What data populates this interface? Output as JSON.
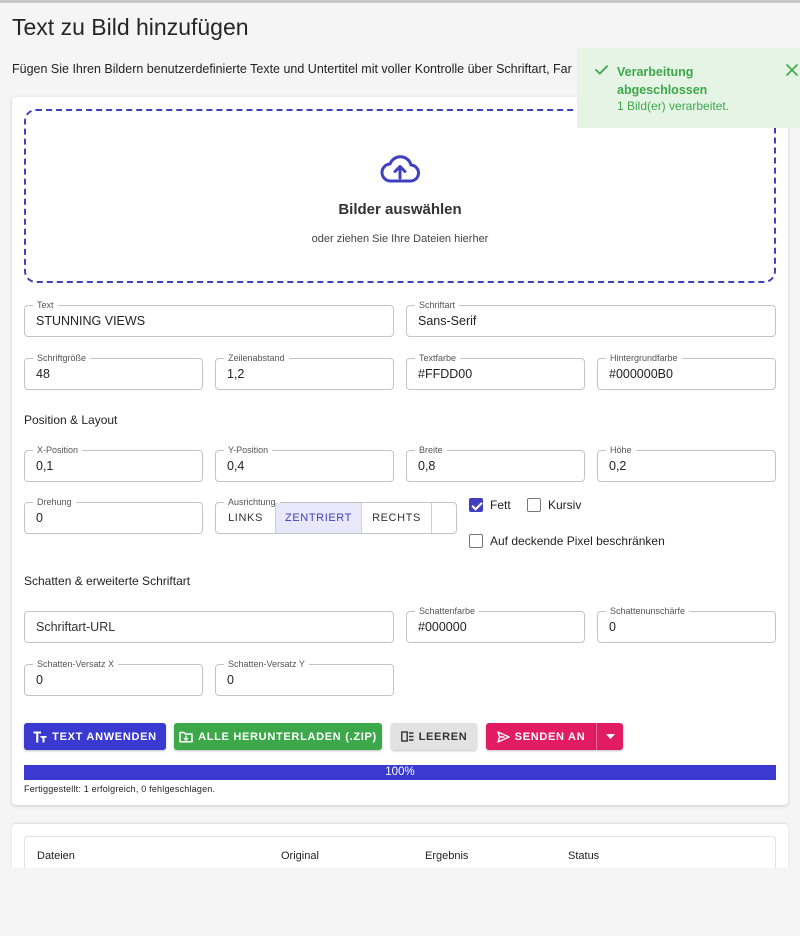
{
  "page": {
    "title": "Text zu Bild hinzufügen",
    "subtitle": "Fügen Sie Ihren Bildern benutzerdefinierte Texte und Untertitel mit voller Kontrolle über Schriftart, Farbe, Position und Schatten hinzu."
  },
  "dropzone": {
    "title": "Bilder auswählen",
    "subtitle": "oder ziehen Sie Ihre Dateien hierher",
    "icon": "cloud-upload-icon"
  },
  "fields": {
    "text": {
      "label": "Text",
      "value": "STUNNING VIEWS"
    },
    "font": {
      "label": "Schriftart",
      "value": "Sans-Serif"
    },
    "font_size": {
      "label": "Schriftgröße",
      "value": "48"
    },
    "line_height": {
      "label": "Zeilenabstand",
      "value": "1,2"
    },
    "text_color": {
      "label": "Textfarbe",
      "value": "#FFDD00"
    },
    "bg_color": {
      "label": "Hintergrundfarbe",
      "value": "#000000B0"
    }
  },
  "position": {
    "section_title": "Position & Layout",
    "x": {
      "label": "X-Position",
      "value": "0,1"
    },
    "y": {
      "label": "Y-Position",
      "value": "0,4"
    },
    "width": {
      "label": "Breite",
      "value": "0,8"
    },
    "height": {
      "label": "Höhe",
      "value": "0,2"
    },
    "rotation": {
      "label": "Drehung",
      "value": "0"
    },
    "alignment": {
      "label": "Ausrichtung",
      "options": [
        "LINKS",
        "ZENTRIERT",
        "RECHTS"
      ],
      "selected": "ZENTRIERT"
    },
    "bold": {
      "label": "Fett",
      "checked": true
    },
    "italic": {
      "label": "Kursiv",
      "checked": false
    },
    "restrict": {
      "label": "Auf deckende Pixel beschränken",
      "checked": false
    }
  },
  "shadow": {
    "section_title": "Schatten & erweiterte Schriftart",
    "font_url": {
      "placeholder": "Schriftart-URL",
      "value": ""
    },
    "color": {
      "label": "Schattenfarbe",
      "value": "#000000"
    },
    "blur": {
      "label": "Schattenunschärfe",
      "value": "0"
    },
    "offset_x": {
      "label": "Schatten-Versatz X",
      "value": "0"
    },
    "offset_y": {
      "label": "Schatten-Versatz Y",
      "value": "0"
    }
  },
  "actions": {
    "apply": "TEXT ANWENDEN",
    "download": "ALLE HERUNTERLADEN (.ZIP)",
    "clear": "LEEREN",
    "send": "SENDEN AN"
  },
  "progress": {
    "value_percent": 100,
    "label": "100%",
    "status": "Fertiggestellt: 1 erfolgreich, 0 fehlgeschlagen."
  },
  "table": {
    "columns": [
      "Dateien",
      "Original",
      "Ergebnis",
      "Status"
    ]
  },
  "toast": {
    "title": "Verarbeitung abgeschlossen",
    "message": "1 Bild(er) verarbeitet."
  },
  "colors": {
    "primary": "#3a3ad1",
    "success": "#3ca84a",
    "accent": "#e21c62",
    "toast_bg": "#e6f4e6"
  }
}
